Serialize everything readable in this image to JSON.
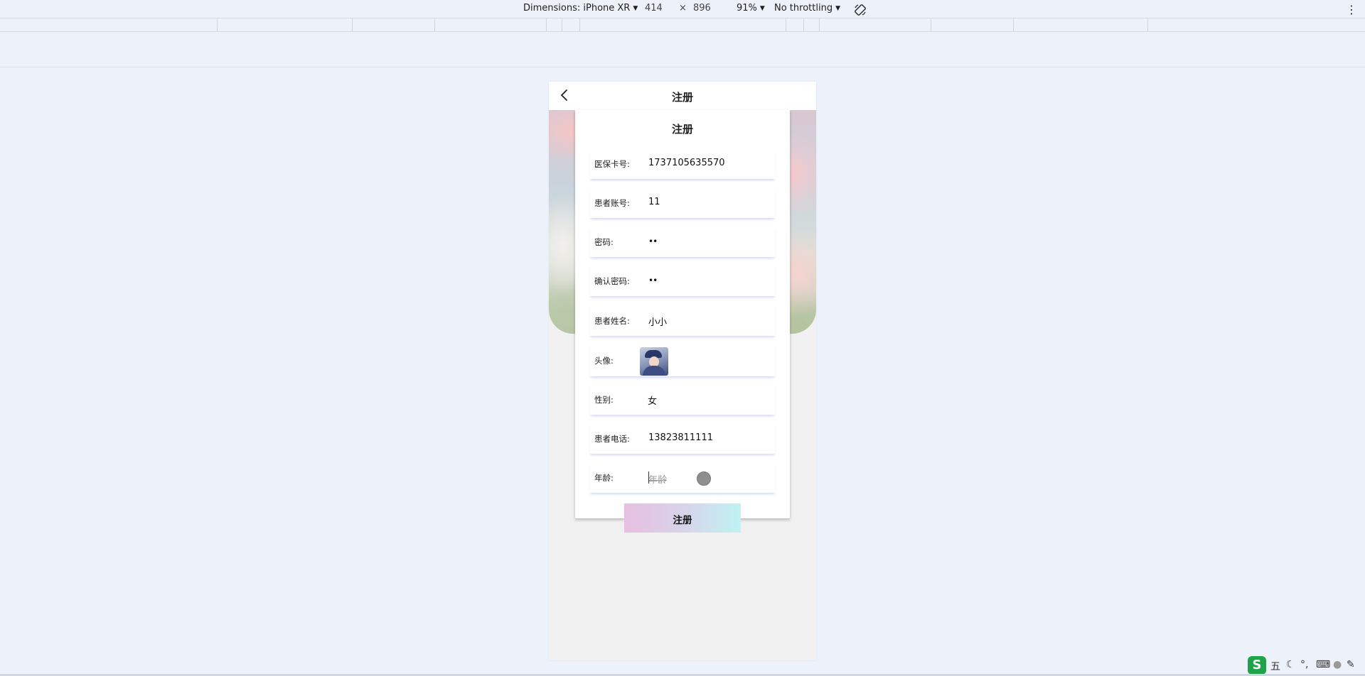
{
  "devtools": {
    "dimensions_label": "Dimensions: iPhone XR",
    "width": "414",
    "times": "×",
    "height": "896",
    "zoom": "91%",
    "throttling": "No throttling"
  },
  "nav": {
    "title": "注册"
  },
  "form": {
    "title": "注册",
    "fields": {
      "card_no": {
        "label": "医保卡号:",
        "value": "1737105635570"
      },
      "account": {
        "label": "患者账号:",
        "value": "11"
      },
      "password": {
        "label": "密码:",
        "value": "••"
      },
      "confirm_password": {
        "label": "确认密码:",
        "value": "••"
      },
      "name": {
        "label": "患者姓名:",
        "value": "小小"
      },
      "avatar": {
        "label": "头像:"
      },
      "gender": {
        "label": "性别:",
        "value": "女"
      },
      "phone": {
        "label": "患者电话:",
        "value": "13823811111"
      },
      "age": {
        "label": "年龄:",
        "placeholder": "年龄"
      }
    },
    "submit_label": "注册"
  },
  "tray": {
    "ime_logo": "S",
    "ime_mode": "五"
  }
}
